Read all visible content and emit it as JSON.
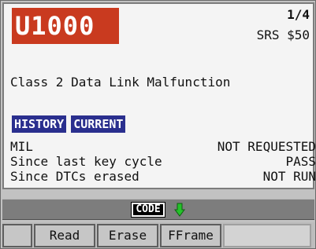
{
  "header": {
    "dtc_code": "U1000",
    "page_indicator": "1/4",
    "module": "SRS $50"
  },
  "description": "Class 2 Data Link Malfunction",
  "tags": [
    "HISTORY",
    "CURRENT"
  ],
  "status_rows": [
    {
      "label": "MIL",
      "value": "NOT REQUESTED"
    },
    {
      "label": "Since last key cycle",
      "value": "PASS"
    },
    {
      "label": "Since DTCs erased",
      "value": "NOT RUN"
    }
  ],
  "footer_bar": {
    "code_icon_label": "CODE",
    "icon": "arrow-down-icon",
    "arrow_color": "#25c22a"
  },
  "softkeys": [
    "",
    "Read",
    "Erase",
    "FFrame",
    ""
  ],
  "colors": {
    "dtc_badge": "#c93a1f",
    "tag_bg": "#2a2f8e"
  }
}
